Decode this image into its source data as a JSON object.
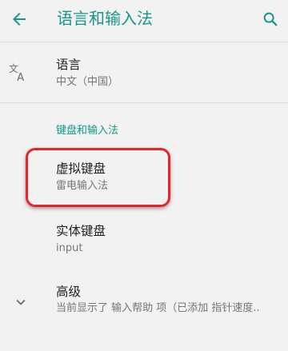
{
  "header": {
    "title": "语言和输入法",
    "back_icon": "arrow-left-icon",
    "search_icon": "search-icon"
  },
  "language": {
    "icon": "translate-icon",
    "title": "语言",
    "subtitle": "中文（中国）"
  },
  "keyboard_section": {
    "header": "键盘和输入法",
    "items": [
      {
        "title": "虚拟键盘",
        "subtitle": "雷电输入法"
      },
      {
        "title": "实体键盘",
        "subtitle": "input"
      }
    ]
  },
  "advanced": {
    "icon": "chevron-down-icon",
    "title": "高级",
    "subtitle": "当前显示了 输入帮助 项（已添加 指针速度.."
  },
  "colors": {
    "accent": "#14978a",
    "highlight": "#e3262c",
    "background": "#f2f2f2"
  }
}
